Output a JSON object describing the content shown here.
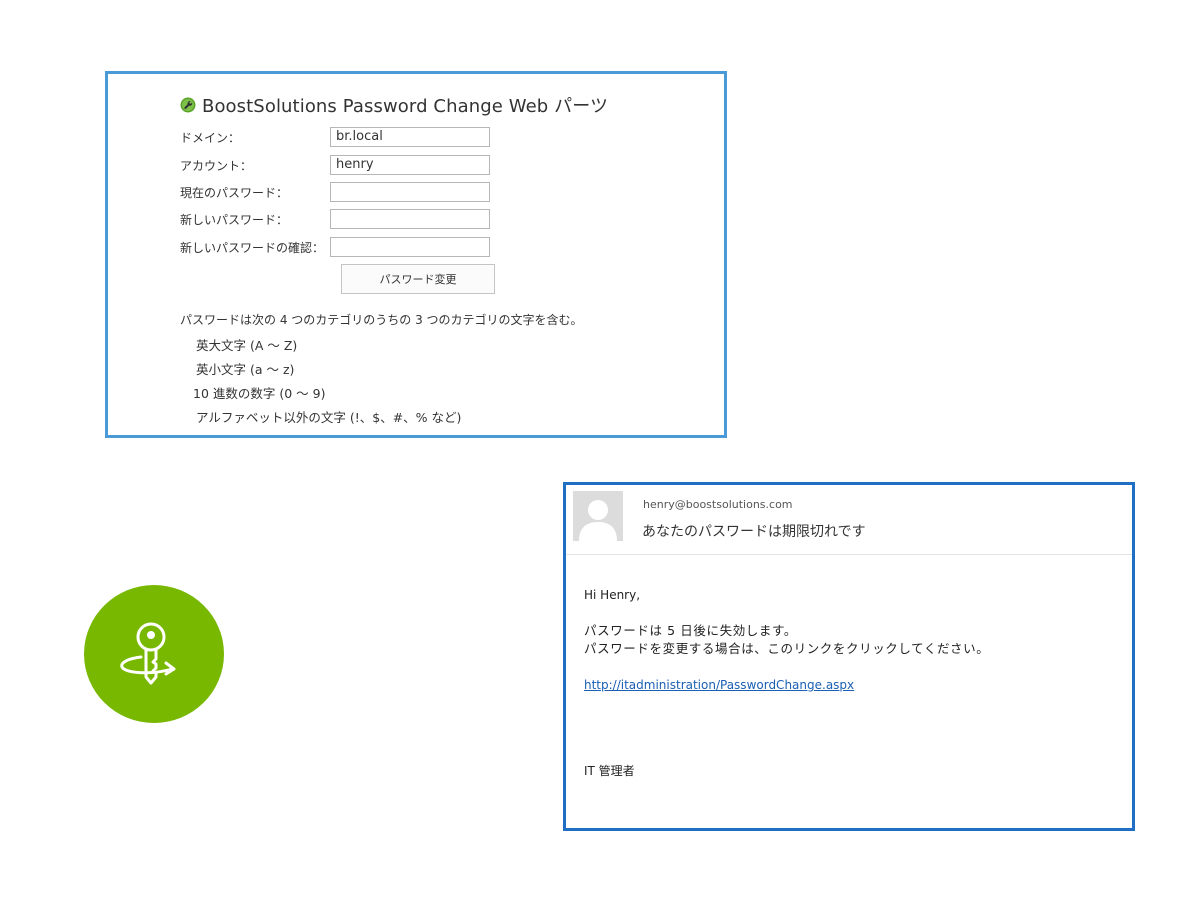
{
  "webpart": {
    "title": "BoostSolutions Password Change Web パーツ",
    "title_icon": "wrench-icon",
    "fields": [
      {
        "label": "ドメイン：",
        "value": "br.local"
      },
      {
        "label": "アカウント：",
        "value": "henry"
      },
      {
        "label": "現在のパスワード：",
        "value": ""
      },
      {
        "label": "新しいパスワード：",
        "value": ""
      },
      {
        "label": "新しいパスワードの確認：",
        "value": ""
      }
    ],
    "submit_label": "パスワード変更",
    "rules_intro": "パスワードは次の 4 つのカテゴリのうちの 3 つのカテゴリの文字を含む。",
    "rules": [
      "英大文字 (A ～ Z)",
      "英小文字 (a ～ z)",
      "10 進数の数字 (0 ～ 9)",
      "アルファベット以外の文字 (!、$、#、% など)"
    ]
  },
  "badge": {
    "icon": "key-rotate-icon",
    "color": "#78b800"
  },
  "email": {
    "avatar_icon": "user-avatar-icon",
    "from": "henry@boostsolutions.com",
    "subject": "あなたのパスワードは期限切れです",
    "greeting": "Hi Henry,",
    "body_line1": "パスワードは 5 日後に失効します。",
    "body_line2": "パスワードを変更する場合は、このリンクをクリックしてください。",
    "link": "http://itadministration/PasswordChange.aspx",
    "signature": "IT 管理者"
  },
  "colors": {
    "webpart_border": "#4a9ad8",
    "email_border": "#1f6fc5",
    "link": "#1a5fb4"
  }
}
